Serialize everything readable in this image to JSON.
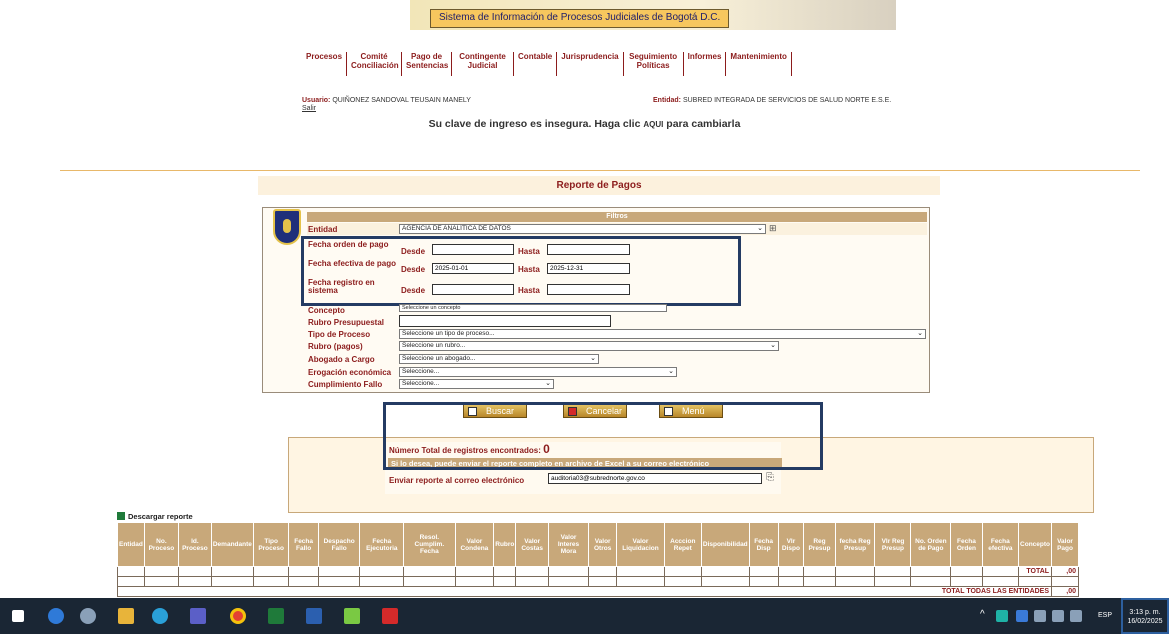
{
  "header": {
    "title": "Sistema de Información de Procesos Judiciales de Bogotá D.C."
  },
  "nav": [
    {
      "label": "Procesos"
    },
    {
      "label": "Comité Conciliación"
    },
    {
      "label": "Pago de Sentencias"
    },
    {
      "label": "Contingente Judicial"
    },
    {
      "label": "Contable"
    },
    {
      "label": "Jurisprudencia"
    },
    {
      "label": "Seguimiento Políticas"
    },
    {
      "label": "Informes"
    },
    {
      "label": "Mantenimiento"
    }
  ],
  "user": {
    "label": "Usuario:",
    "name": "QUIÑONEZ SANDOVAL TEUSAIN MANELY",
    "logout": "Salir",
    "entity_label": "Entidad:",
    "entity": "SUBRED INTEGRADA DE SERVICIOS DE SALUD NORTE E.S.E."
  },
  "warning": {
    "before": "Su clave de ingreso es insegura. Haga clic ",
    "link": "AQUI",
    "after": " para cambiarla"
  },
  "report_title": "Reporte de Pagos",
  "filters": {
    "heading": "Filtros",
    "entidad_label": "Entidad",
    "entidad_value": "AGENCIA DE ANALÍTICA DE DATOS",
    "fecha_orden_label": "Fecha orden de pago",
    "fecha_efectiva_label": "Fecha efectiva de pago",
    "fecha_registro_label": "Fecha registro en sistema",
    "desde_label": "Desde",
    "hasta_label": "Hasta",
    "efectiva_desde": "2025-01-01",
    "efectiva_hasta": "2025-12-31",
    "concepto_label": "Concepto",
    "concepto_value": "Seleccione un concepto",
    "rubro_presup_label": "Rubro Presupuestal",
    "tipo_proceso_label": "Tipo de Proceso",
    "tipo_proceso_value": "Seleccione un tipo de proceso...",
    "rubro_pagos_label": "Rubro (pagos)",
    "rubro_pagos_value": "Seleccione un rubro...",
    "abogado_label": "Abogado a Cargo",
    "abogado_value": "Seleccione un abogado...",
    "erogacion_label": "Erogación económica",
    "erogacion_value": "Seleccione...",
    "cumplimiento_label": "Cumplimiento Fallo",
    "cumplimiento_value": "Seleccione..."
  },
  "buttons": {
    "buscar": "Buscar",
    "cancelar": "Cancelar",
    "menu": "Menú"
  },
  "results": {
    "count_label": "Número Total de registros encontrados:",
    "count_value": "0",
    "excel_note": "Si lo desea, puede enviar el reporte completo en archivo de Excel a su correo electrónico",
    "email_label": "Enviar reporte al correo electrónico",
    "email_value": "auditoria03@subrednorte.gov.co"
  },
  "table": {
    "download_label": "Descargar reporte",
    "columns": [
      "Entidad",
      "No. Proceso",
      "Id. Proceso",
      "Demandante",
      "Tipo Proceso",
      "Fecha Fallo",
      "Despacho Fallo",
      "Fecha Ejecutoria",
      "Resol. Cumplim. Fecha",
      "Valor Condena",
      "Rubro",
      "Valor Costas",
      "Valor Interes Mora",
      "Valor Otros",
      "Valor Liquidacion",
      "Acccion Repet",
      "Disponibilidad",
      "Fecha Disp",
      "Vlr Dispo",
      "Reg Presup",
      "fecha Reg Presup",
      "Vlr Reg Presup",
      "No. Orden de Pago",
      "Fecha Orden",
      "Fecha efectiva",
      "Concepto",
      "Valor Pago"
    ],
    "total_label": "TOTAL",
    "total_value": ",00",
    "grand_total_label": "TOTAL TODAS LAS ENTIDADES",
    "grand_total_value": ",00"
  },
  "taskbar": {
    "language": "ESP",
    "time": "3:13 p. m.",
    "date": "16/02/2025"
  }
}
